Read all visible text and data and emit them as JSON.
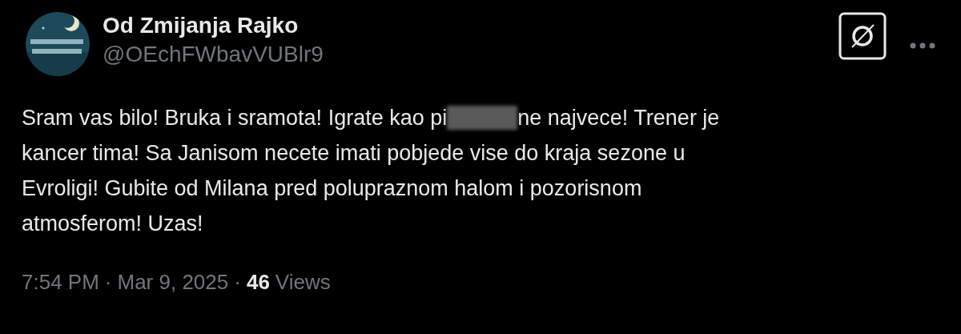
{
  "author": {
    "display_name": "Od Zmijanja Rajko",
    "handle": "@OEchFWbavVUBlr9"
  },
  "body": {
    "lines": [
      [
        {
          "kind": "text",
          "text": "Sram vas bilo! Bruka i sramota! Igrate kao pi"
        },
        {
          "kind": "redaction"
        },
        {
          "kind": "text",
          "text": "ne najvece! Trener je"
        }
      ],
      [
        {
          "kind": "text",
          "text": "kancer tima! Sa Janisom necete imati pobjede vise do kraja sezone u"
        }
      ],
      [
        {
          "kind": "text",
          "text": "Evroligi! Gubite od Milana pred polupraznom halom i pozorisnom"
        }
      ],
      [
        {
          "kind": "text",
          "text": "atmosferom! Uzas!"
        }
      ]
    ]
  },
  "meta": {
    "time": "7:54 PM",
    "separator_1": "·",
    "date": "Mar 9, 2025",
    "separator_2": "·",
    "views_count": "46",
    "views_label": "Views"
  }
}
